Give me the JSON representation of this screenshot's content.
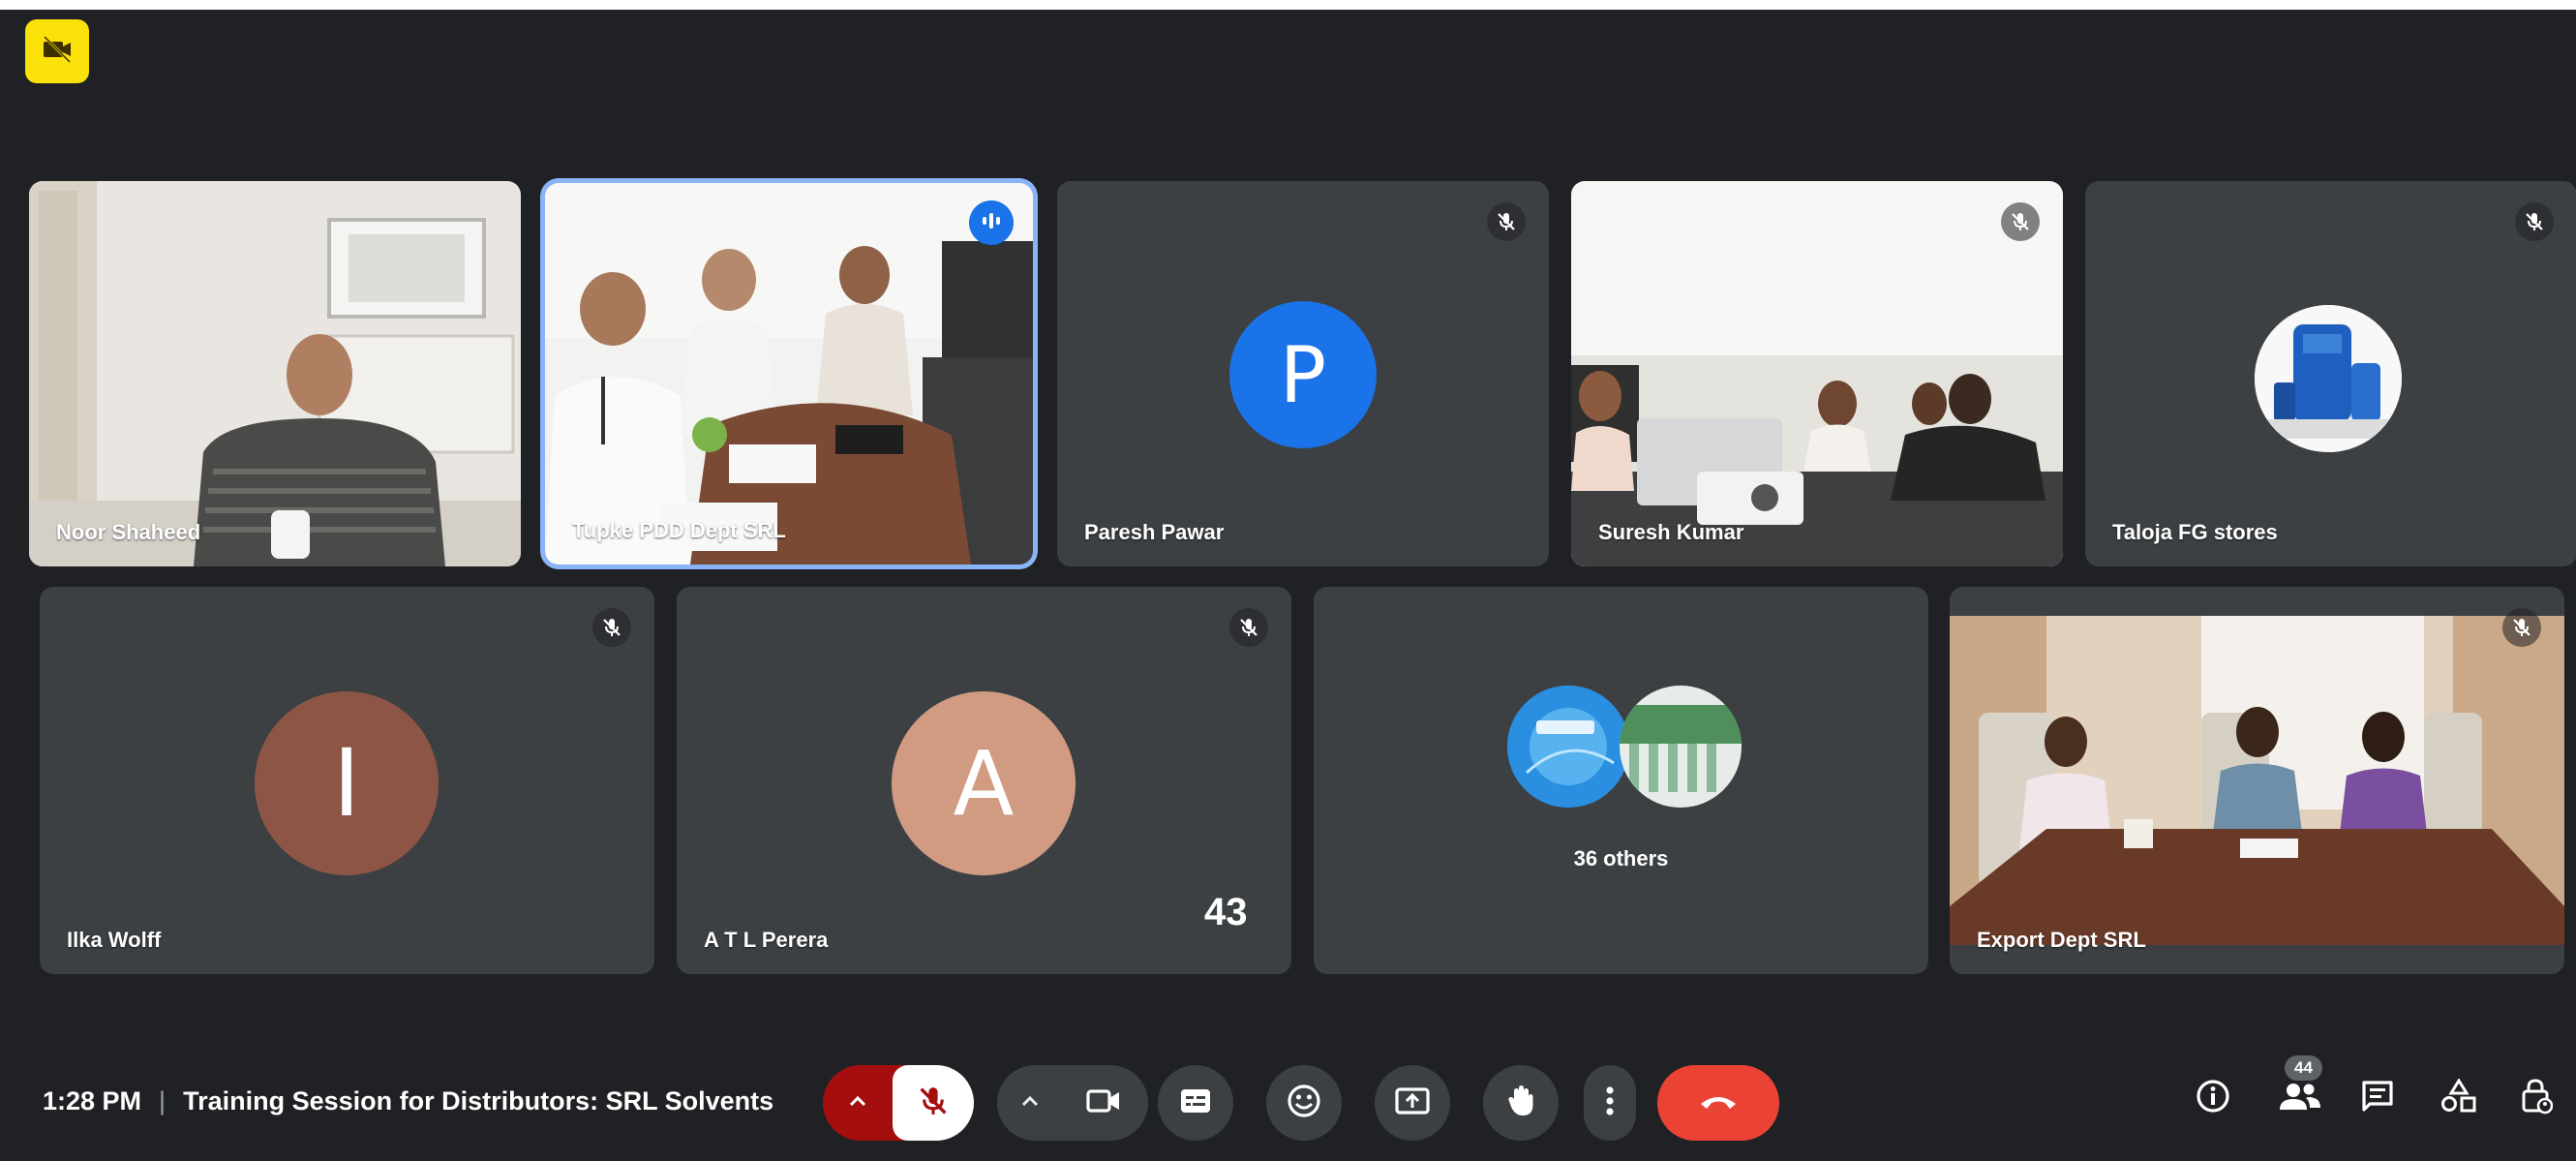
{
  "app": {
    "accent": "#1a73e8",
    "end_call_color": "#ea4335",
    "mute_red": "#a50e0e"
  },
  "tiles": [
    {
      "name": "Noor Shaheed",
      "muted": false,
      "type": "video"
    },
    {
      "name": "Tupke PDD Dept SRL",
      "muted": false,
      "type": "video",
      "speaking": true
    },
    {
      "name": "Paresh Pawar",
      "muted": true,
      "type": "avatar",
      "initial": "P",
      "avatar_color": "#1a73e8"
    },
    {
      "name": "Suresh Kumar",
      "muted": true,
      "type": "video"
    },
    {
      "name": "Taloja FG stores",
      "muted": true,
      "type": "image-avatar"
    },
    {
      "name": "Ilka Wolff",
      "muted": true,
      "type": "avatar",
      "initial": "I",
      "avatar_color": "#8d5545"
    },
    {
      "name": "A T L Perera",
      "muted": true,
      "type": "avatar",
      "initial": "A",
      "avatar_color": "#d19b82"
    },
    {
      "name": "",
      "type": "others",
      "others_label": "36 others"
    },
    {
      "name": "Export Dept SRL",
      "muted": true,
      "type": "video"
    }
  ],
  "overlay_number": "43",
  "meeting": {
    "time": "1:28 PM",
    "separator": "|",
    "title": "Training Session for Distributors: SRL Solvents"
  },
  "controls": [
    "mic-options",
    "mic",
    "camera-options",
    "camera",
    "captions",
    "emoji",
    "present",
    "raise-hand",
    "more",
    "end-call"
  ],
  "right_icons": {
    "people_count": "44",
    "items": [
      "info",
      "people",
      "chat",
      "activities",
      "host-controls"
    ]
  }
}
